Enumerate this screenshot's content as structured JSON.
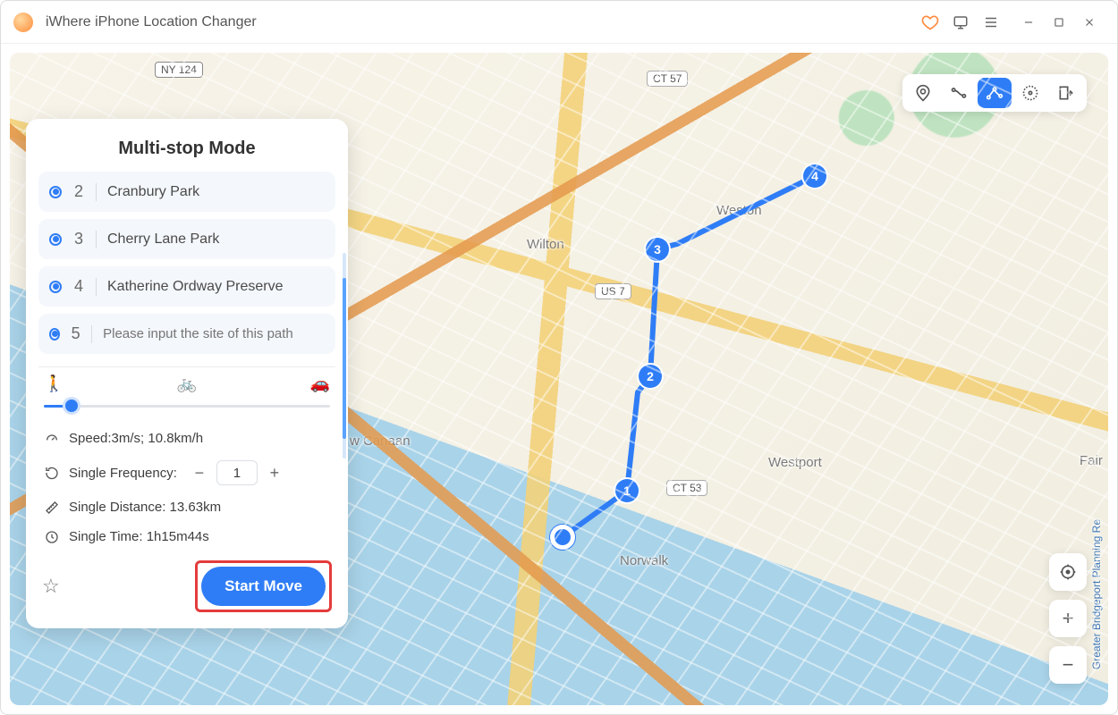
{
  "app": {
    "title": "iWhere iPhone Location Changer"
  },
  "panel": {
    "title": "Multi-stop Mode",
    "stops": [
      {
        "num": "2",
        "label": "Cranbury Park"
      },
      {
        "num": "3",
        "label": "Cherry Lane Park"
      },
      {
        "num": "4",
        "label": "Katherine Ordway Preserve"
      }
    ],
    "pending": {
      "num": "5",
      "placeholder": "Please input the site of this path"
    },
    "speed_text": "Speed:3m/s; 10.8km/h",
    "frequency_label": "Single Frequency:",
    "frequency_value": "1",
    "distance_text": "Single Distance: 13.63km",
    "time_text": "Single Time: 1h15m44s",
    "start_label": "Start Move"
  },
  "map": {
    "labels": {
      "wilton": "Wilton",
      "weston": "Weston",
      "westport": "Westport",
      "norwalk": "Norwalk",
      "canaan": "w Canaan",
      "fair": "Fair"
    },
    "shields": {
      "ny124": "NY 124",
      "ct57": "CT 57",
      "us7": "US 7",
      "ct53": "CT 53"
    },
    "watermark": "Greater Bridgeport Planning Re"
  }
}
